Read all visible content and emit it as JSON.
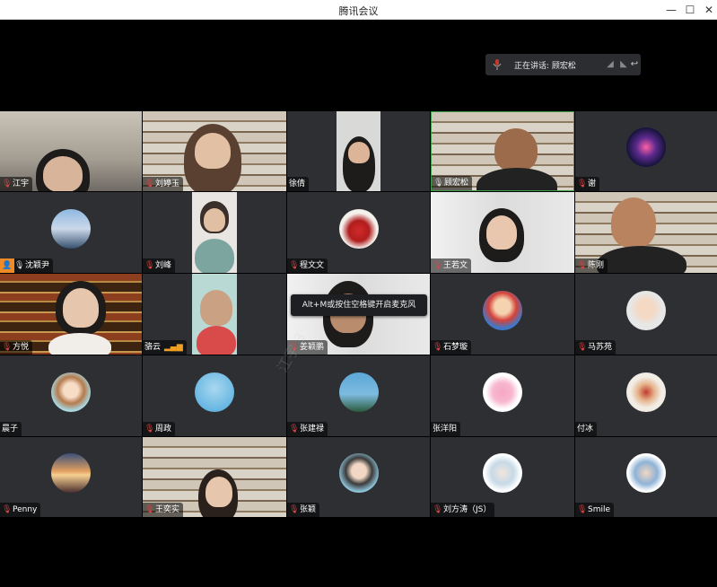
{
  "window": {
    "title": "腾讯会议",
    "minimize": "—",
    "maximize": "☐",
    "close": "✕"
  },
  "speaking": {
    "text": "正在讲话: 顾宏松"
  },
  "tooltip": {
    "text": "Alt+M或按住空格键开启麦克风"
  },
  "watermark": {
    "text": "江宇 3"
  },
  "participants": [
    {
      "name": "江宇"
    },
    {
      "name": "刘婷玉"
    },
    {
      "name": "徐倩"
    },
    {
      "name": "顾宏松"
    },
    {
      "name": "谢"
    },
    {
      "name": "沈颖尹"
    },
    {
      "name": "刘峰"
    },
    {
      "name": "程文文"
    },
    {
      "name": "王若文"
    },
    {
      "name": "陈刚"
    },
    {
      "name": "方悦"
    },
    {
      "name": "骆云"
    },
    {
      "name": "姜颖鹏"
    },
    {
      "name": "石梦璇"
    },
    {
      "name": "马苏苑"
    },
    {
      "name": "晨子"
    },
    {
      "name": "周政"
    },
    {
      "name": "张建禄"
    },
    {
      "name": "张洋阳"
    },
    {
      "name": "付冰"
    },
    {
      "name": "Penny"
    },
    {
      "name": "王奕实"
    },
    {
      "name": "张颖"
    },
    {
      "name": "刘方涛（JS）"
    },
    {
      "name": "Smile"
    }
  ]
}
